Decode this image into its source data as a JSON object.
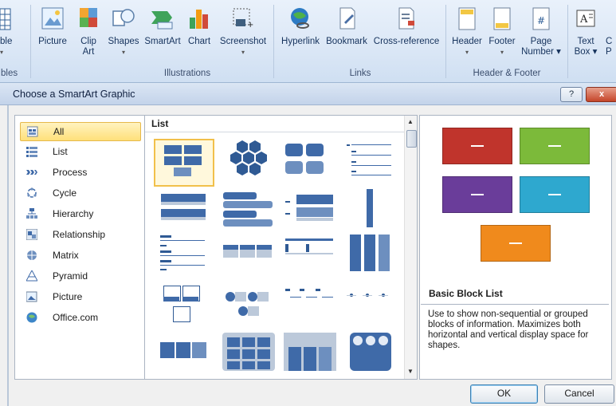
{
  "ribbon": {
    "left_labels": {
      "top": "ble",
      "bottom": "bles"
    },
    "buttons": [
      {
        "label": "Picture",
        "icon": "picture-icon"
      },
      {
        "label": "Clip",
        "label2": "Art",
        "icon": "clip-art-icon"
      },
      {
        "label": "Shapes",
        "icon": "shapes-icon",
        "has_arrow": true
      },
      {
        "label": "SmartArt",
        "icon": "smartart-icon"
      },
      {
        "label": "Chart",
        "icon": "chart-icon"
      },
      {
        "label": "Screenshot",
        "icon": "screenshot-icon",
        "has_arrow": true
      },
      {
        "label": "Hyperlink",
        "icon": "hyperlink-icon"
      },
      {
        "label": "Bookmark",
        "icon": "bookmark-icon"
      },
      {
        "label": "Cross-reference",
        "icon": "cross-reference-icon"
      },
      {
        "label": "Header",
        "icon": "header-icon",
        "has_arrow": true
      },
      {
        "label": "Footer",
        "icon": "footer-icon",
        "has_arrow": true
      },
      {
        "label": "Page",
        "label2": "Number ▾",
        "icon": "page-number-icon"
      },
      {
        "label": "Text",
        "label2": "Box ▾",
        "icon": "text-box-icon"
      },
      {
        "label": "C",
        "label2": "P",
        "icon": "partial-icon"
      }
    ],
    "groups": [
      "Illustrations",
      "Links",
      "Header & Footer"
    ]
  },
  "dialog": {
    "title": "Choose a SmartArt Graphic",
    "help_label": "?",
    "close_label": "x",
    "categories": [
      "All",
      "List",
      "Process",
      "Cycle",
      "Hierarchy",
      "Relationship",
      "Matrix",
      "Pyramid",
      "Picture",
      "Office.com"
    ],
    "selected_category": "All",
    "gallery_heading": "List",
    "preview": {
      "name": "Basic Block List",
      "description": "Use to show non-sequential or grouped blocks of information. Maximizes both horizontal and vertical display space for shapes.",
      "colors": [
        "#c0342c",
        "#7cba3a",
        "#6a3d9a",
        "#2ea8cf",
        "#f08a1c"
      ]
    },
    "ok_label": "OK",
    "cancel_label": "Cancel"
  }
}
